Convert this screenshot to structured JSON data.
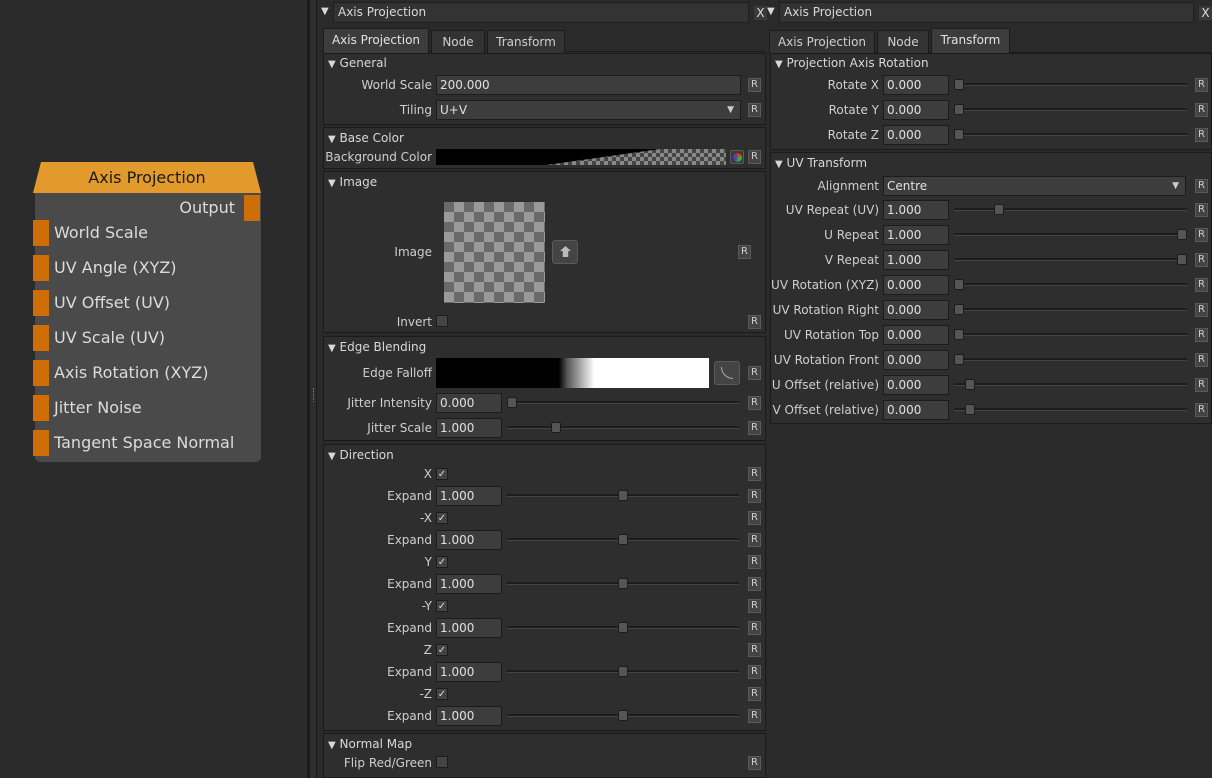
{
  "node": {
    "title": "Axis Projection",
    "output_label": "Output",
    "inputs": [
      "World Scale",
      "UV Angle (XYZ)",
      "UV Offset (UV)",
      "UV Scale (UV)",
      "Axis Rotation (XYZ)",
      "Jitter Noise",
      "Tangent Space Normal"
    ]
  },
  "left_panel": {
    "title": "Axis Projection",
    "tabs": [
      "Axis Projection",
      "Node",
      "Transform"
    ],
    "active_tab": "Axis Projection",
    "general": {
      "header": "General",
      "world_scale_label": "World Scale",
      "world_scale_value": "200.000",
      "tiling_label": "Tiling",
      "tiling_value": "U+V"
    },
    "base_color": {
      "header": "Base Color",
      "bg_label": "Background Color"
    },
    "image": {
      "header": "Image",
      "image_label": "Image",
      "invert_label": "Invert"
    },
    "edge_blending": {
      "header": "Edge Blending",
      "falloff_label": "Edge Falloff",
      "jitter_intensity_label": "Jitter Intensity",
      "jitter_intensity_value": "0.000",
      "jitter_intensity_level": 0.0,
      "jitter_scale_label": "Jitter Scale",
      "jitter_scale_value": "1.000",
      "jitter_scale_level": 0.2
    },
    "direction": {
      "header": "Direction",
      "rows": [
        {
          "axis": "X",
          "expand_label": "Expand",
          "expand": "1.000",
          "level": 0.5
        },
        {
          "axis": "-X",
          "expand_label": "Expand",
          "expand": "1.000",
          "level": 0.5
        },
        {
          "axis": "Y",
          "expand_label": "Expand",
          "expand": "1.000",
          "level": 0.5
        },
        {
          "axis": "-Y",
          "expand_label": "Expand",
          "expand": "1.000",
          "level": 0.5
        },
        {
          "axis": "Z",
          "expand_label": "Expand",
          "expand": "1.000",
          "level": 0.5
        },
        {
          "axis": "-Z",
          "expand_label": "Expand",
          "expand": "1.000",
          "level": 0.5
        }
      ],
      "check_glyph": "✓"
    },
    "normal_map": {
      "header": "Normal Map",
      "flip_label": "Flip Red/Green"
    }
  },
  "right_panel": {
    "title": "Axis Projection",
    "tabs": [
      "Axis Projection",
      "Node",
      "Transform"
    ],
    "active_tab": "Transform",
    "rotation": {
      "header": "Projection Axis Rotation",
      "rows": [
        {
          "label": "Rotate X",
          "value": "0.000",
          "level": 0.0
        },
        {
          "label": "Rotate Y",
          "value": "0.000",
          "level": 0.0
        },
        {
          "label": "Rotate Z",
          "value": "0.000",
          "level": 0.0
        }
      ]
    },
    "uv_transform": {
      "header": "UV Transform",
      "alignment_label": "Alignment",
      "alignment_value": "Centre",
      "rows": [
        {
          "label": "UV Repeat (UV)",
          "value": "1.000",
          "level": 0.18
        },
        {
          "label": "U Repeat",
          "value": "1.000",
          "level": 1.0
        },
        {
          "label": "V Repeat",
          "value": "1.000",
          "level": 1.0
        },
        {
          "label": "UV Rotation (XYZ)",
          "value": "0.000",
          "level": 0.0
        },
        {
          "label": "UV Rotation Right",
          "value": "0.000",
          "level": 0.0
        },
        {
          "label": "UV Rotation Top",
          "value": "0.000",
          "level": 0.0
        },
        {
          "label": "UV Rotation Front",
          "value": "0.000",
          "level": 0.0
        },
        {
          "label": "U Offset (relative)",
          "value": "0.000",
          "level": 0.05
        },
        {
          "label": "V Offset (relative)",
          "value": "0.000",
          "level": 0.05
        }
      ]
    }
  },
  "common": {
    "reset_label": "R",
    "close_label": "X",
    "collapse_glyph": "▼",
    "dropdown_glyph": "▼"
  }
}
